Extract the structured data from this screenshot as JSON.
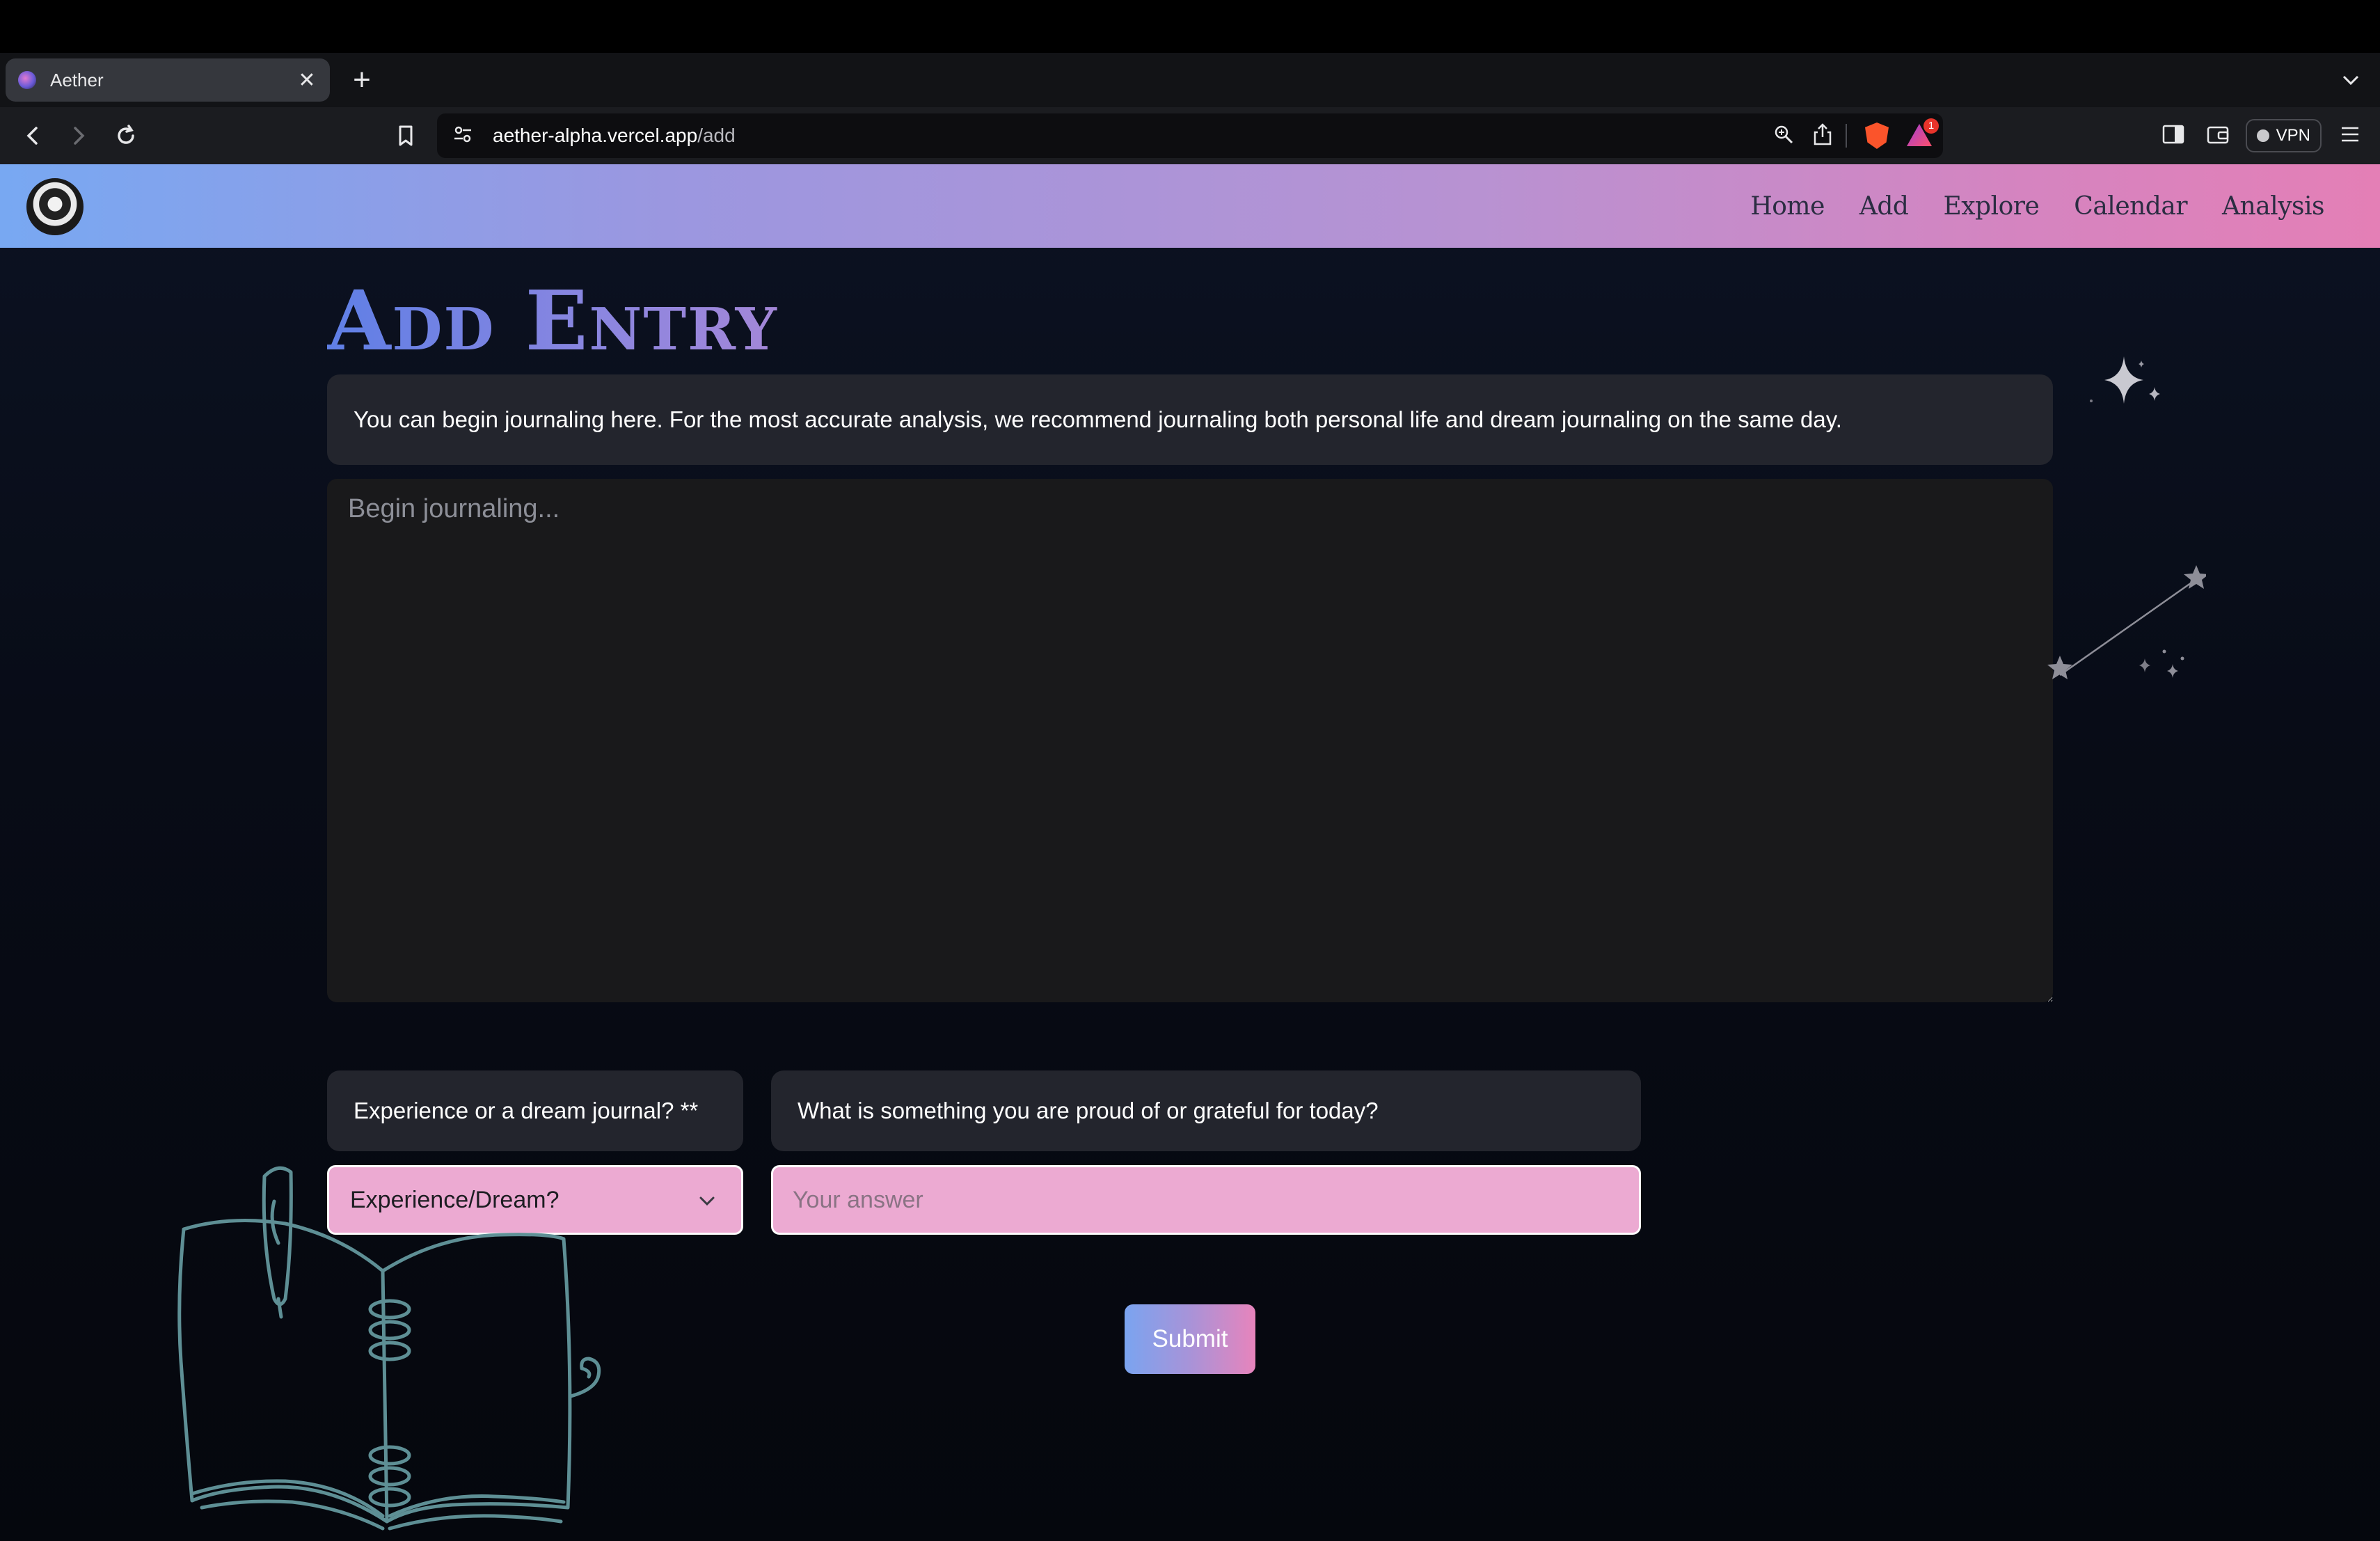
{
  "browser": {
    "tab_title": "Aether",
    "url_host": "aether-alpha.vercel.app",
    "url_path": "/add",
    "rewards_count": "1",
    "vpn_label": "VPN"
  },
  "nav": {
    "links": [
      "Home",
      "Add",
      "Explore",
      "Calendar",
      "Analysis"
    ]
  },
  "page": {
    "title": "Add Entry",
    "intro": "You can begin journaling here. For the most accurate analysis, we recommend journaling both personal life and dream journaling on the same day.",
    "journal_placeholder": "Begin journaling...",
    "question_type": "Experience or a dream journal? **",
    "question_grateful": "What is something you are proud of or grateful for today?",
    "select_value": "Experience/Dream?",
    "answer_placeholder": "Your answer",
    "submit_label": "Submit"
  },
  "colors": {
    "nav_gradient_start": "#78a8f2",
    "nav_gradient_end": "#e47fb6",
    "input_pink": "#ecaad2",
    "panel": "#23252d",
    "doodle": "#5e8f95"
  }
}
